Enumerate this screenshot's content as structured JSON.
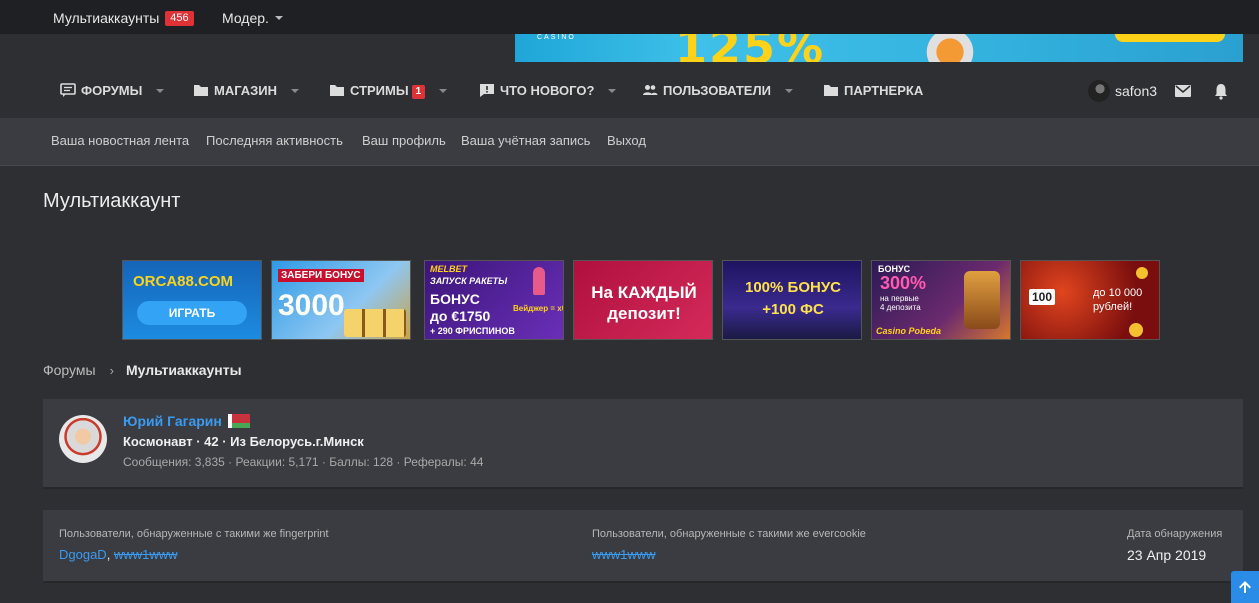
{
  "topbar": {
    "multi_label": "Мультиаккаунты",
    "multi_count": "456",
    "moder_label": "Модер."
  },
  "top_banner": {
    "big_text": "125%",
    "small_text": "CASINO"
  },
  "nav": {
    "tabs": [
      {
        "label": "Форумы",
        "icon": "forum-icon"
      },
      {
        "label": "Магазин",
        "icon": "folder-icon"
      },
      {
        "label": "Стримы",
        "icon": "folder-icon",
        "badge": "1"
      },
      {
        "label": "Что нового?",
        "icon": "alert-bubble-icon"
      },
      {
        "label": "Пользователи",
        "icon": "users-icon"
      },
      {
        "label": "Партнерка",
        "icon": "folder-icon"
      }
    ],
    "username": "safon3"
  },
  "subnav": {
    "items": [
      "Ваша новостная лента",
      "Последняя активность",
      "Ваш профиль",
      "Ваша учётная запись",
      "Выход"
    ]
  },
  "page": {
    "title": "Мультиаккаунт"
  },
  "ads": [
    {
      "line1": "ORCA88.COM",
      "line2": "ИГРАТЬ",
      "bg": "#1c79c9"
    },
    {
      "line1": "ЗАБЕРИ БОНУС",
      "line2": "3000",
      "bg": "#2c8fd8"
    },
    {
      "line1": "MELBET",
      "line2": "ЗАПУСК РАКЕТЫ",
      "line3": "БОНУС",
      "line4": "до €1750",
      "line5": "+ 290 ФРИСПИНОВ",
      "line6": "Вейджер = x0!",
      "bg": "#4b1f8f"
    },
    {
      "line1": "На КАЖДЫЙ",
      "line2": "депозит!",
      "bg": "#c0174a"
    },
    {
      "line1": "100% БОНУС",
      "line2": "+100 ФС",
      "bg": "#2a1a6e"
    },
    {
      "line1": "БОНУС",
      "line2": "300%",
      "line3": "на первые",
      "line4": "4 депозита",
      "line5": "Casino Pobeda",
      "bg": "#3a1f5c"
    },
    {
      "line1": "до 10 000",
      "line2": "рублей!",
      "line3": "100",
      "bg": "#7a0e0e"
    }
  ],
  "breadcrumb": {
    "root": "Форумы",
    "current": "Мультиаккаунты"
  },
  "profile": {
    "name": "Юрий Гагарин",
    "subtitle": "Космонавт · 42 · Из Белорусь.г.Минск",
    "stats": "Сообщения: 3,835 · Реакции: 5,171 · Баллы: 128 · Рефералы: 44"
  },
  "detection": {
    "fingerprint_header": "Пользователи, обнаруженные с такими же fingerprint",
    "fingerprint_users": [
      "DgogaD",
      "www1www"
    ],
    "evercookie_header": "Пользователи, обнаруженные с такими же evercookie",
    "evercookie_users": [
      "www1www"
    ],
    "date_header": "Дата обнаружения",
    "date_value": "23 Апр 2019"
  },
  "colors": {
    "accent_link": "#3a9bf0",
    "badge_red": "#e03137",
    "page_bg": "#2d2f33",
    "panel_bg": "#3a3c41"
  }
}
